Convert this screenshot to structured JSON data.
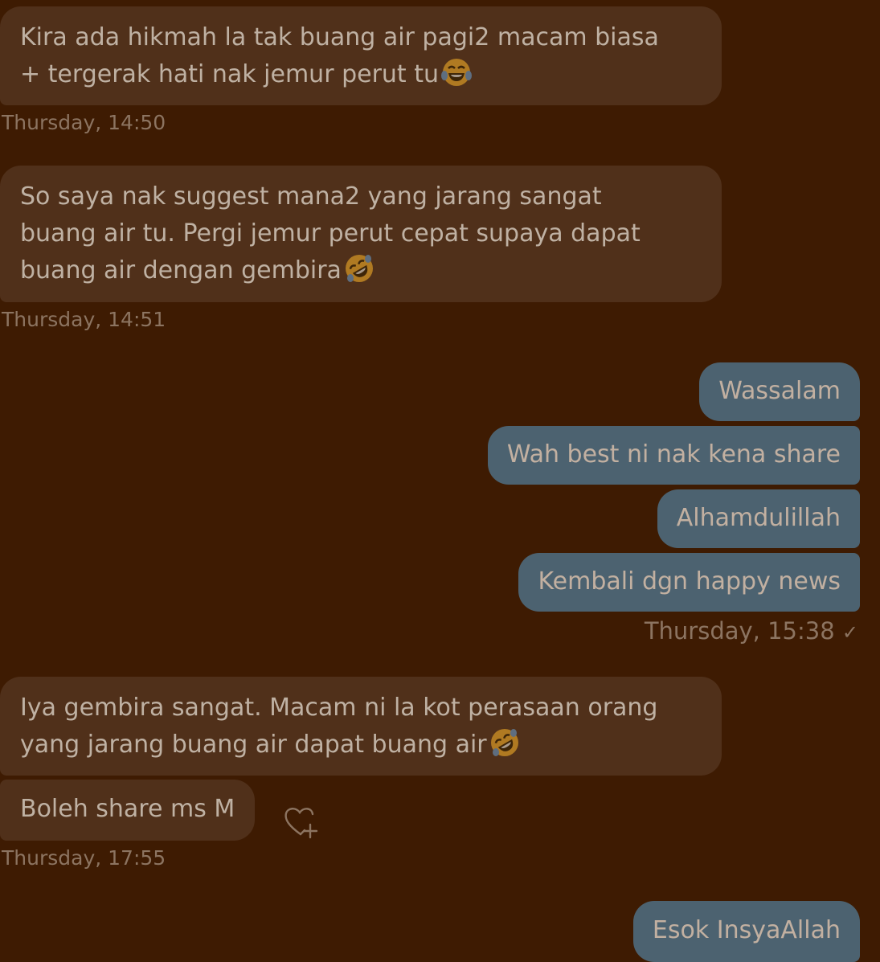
{
  "messages": [
    {
      "lines": [
        "Kira ada hikmah la tak buang air pagi2 macam biasa",
        "+ tergerak hati nak jemur perut tu"
      ],
      "emoji": "face-with-tears-of-joy-icon",
      "time": "Thursday, 14:50"
    },
    {
      "lines": [
        "So saya nak suggest mana2 yang jarang sangat",
        "buang air tu. Pergi jemur perut cepat supaya dapat",
        "buang air dengan gembira"
      ],
      "emoji": "rolling-on-floor-laughing-icon",
      "time": "Thursday, 14:51"
    },
    {
      "sent": [
        "Wassalam",
        "Wah best ni nak kena share",
        "Alhamdulillah",
        "Kembali dgn happy news"
      ],
      "time": "Thursday, 15:38",
      "status": "✓"
    },
    {
      "lines": [
        "Iya gembira sangat. Macam ni la kot perasaan orang",
        "yang jarang buang air dapat buang air"
      ],
      "emoji": "rolling-on-floor-laughing-icon"
    },
    {
      "text": "Boleh share ms M",
      "time": "Thursday, 17:55",
      "reaction_icon": "add-reaction-heart-icon"
    },
    {
      "sent_text": "Esok InsyaAllah"
    }
  ],
  "colors": {
    "background": "#3e1b02",
    "received_bubble": "#50301a",
    "sent_bubble": "#4c6270",
    "text": "#bfb1a3",
    "timestamp": "#8c7461"
  }
}
